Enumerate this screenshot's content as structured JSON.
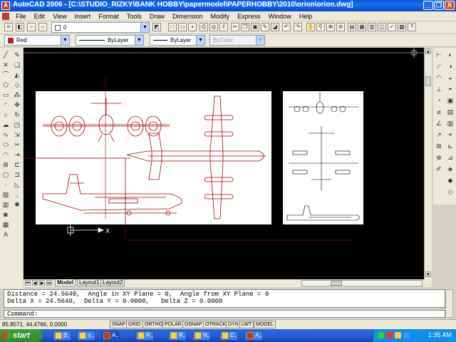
{
  "window": {
    "title": "AutoCAD 2006 - [C:\\STUDIO_RIZKY\\BANK HOBBY\\papermodel\\PAPERHOBBY\\2010\\orion\\orion.dwg]",
    "minimize": "_",
    "restore": "❐",
    "close": "X"
  },
  "menu": [
    "File",
    "Edit",
    "View",
    "Insert",
    "Format",
    "Tools",
    "Draw",
    "Dimension",
    "Modify",
    "Express",
    "Window",
    "Help"
  ],
  "layers": {
    "current_layer": "0",
    "color": "Red",
    "color_hex": "#ff0000",
    "linetype": "ByLayer",
    "lineweight": "ByLayer",
    "plotstyle": "ByColor"
  },
  "tabs": {
    "model": "Model",
    "layout1": "Layout1",
    "layout2": "Layout2"
  },
  "ucs_label": "X",
  "command": {
    "history_line1": "Distance = 24.5640,  Angle in XY Plane = 0,  Angle from XY Plane = 0",
    "history_line2": "Delta X = 24.5640,  Delta Y = 0.0000,   Delta Z = 0.0000",
    "prompt": "Command:"
  },
  "status": {
    "coords": "85.8571, 44.4766, 0.0000",
    "toggles": [
      "SNAP",
      "GRID",
      "ORTHO",
      "POLAR",
      "OSNAP",
      "OTRACK",
      "DYN",
      "LWT",
      "MODEL"
    ]
  },
  "taskbar": {
    "start": "start",
    "tasks": [
      "B...",
      "o...",
      "A...",
      "R...",
      "R...",
      "N...",
      "C...",
      "A..."
    ],
    "clock": "1:35 AM"
  },
  "colors": {
    "drawing_background": "#000000",
    "drawing_lines": "#8b0000",
    "sheet": "#ffffff"
  }
}
